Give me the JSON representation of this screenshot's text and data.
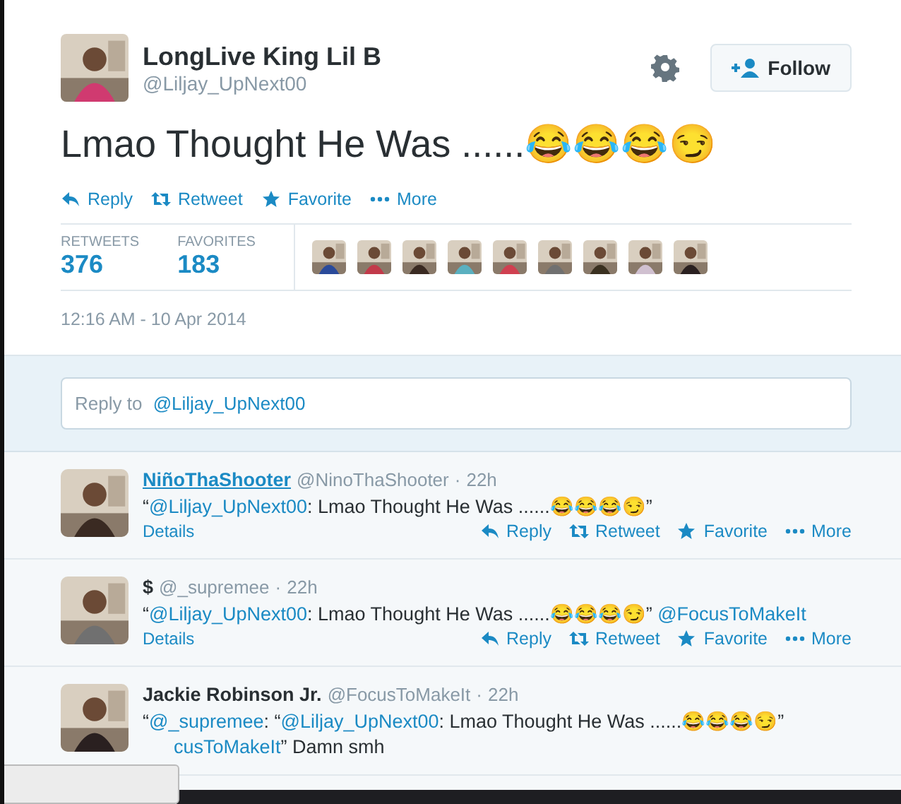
{
  "tweet": {
    "name": "LongLive King Lil B",
    "handle": "@Liljay_UpNext00",
    "follow_label": "Follow",
    "text": "Lmao Thought He Was ......😂😂😂😏",
    "actions": [
      {
        "kind": "reply",
        "label": "Reply"
      },
      {
        "kind": "retweet",
        "label": "Retweet"
      },
      {
        "kind": "favorite",
        "label": "Favorite"
      },
      {
        "kind": "more",
        "label": "More"
      }
    ],
    "stats": [
      {
        "label": "RETWEETS",
        "value": "376"
      },
      {
        "label": "FAVORITES",
        "value": "183"
      }
    ],
    "timestamp": "12:16 AM - 10 Apr 2014"
  },
  "reply_box": {
    "placeholder": "Reply to ",
    "mention": "@Liljay_UpNext00"
  },
  "replies": [
    {
      "name": "NiñoThaShooter",
      "name_link": true,
      "handle": "@NinoThaShooter",
      "separator": "·",
      "time": "22h",
      "lines": [
        [
          {
            "kind": "plain",
            "text": "“"
          },
          {
            "kind": "mention",
            "text": "@Liljay_UpNext00"
          },
          {
            "kind": "plain",
            "text": ": Lmao Thought He Was ......😂😂😂😏”"
          }
        ]
      ],
      "details": "Details",
      "actions": [
        {
          "kind": "reply",
          "label": "Reply"
        },
        {
          "kind": "retweet",
          "label": "Retweet"
        },
        {
          "kind": "favorite",
          "label": "Favorite"
        },
        {
          "kind": "more",
          "label": "More"
        }
      ]
    },
    {
      "name": "$",
      "name_link": false,
      "handle": "@_supremee",
      "separator": "·",
      "time": "22h",
      "lines": [
        [
          {
            "kind": "plain",
            "text": "“"
          },
          {
            "kind": "mention",
            "text": "@Liljay_UpNext00"
          },
          {
            "kind": "plain",
            "text": ": Lmao Thought He Was ......😂😂😂😏” "
          },
          {
            "kind": "mention",
            "text": "@FocusToMakeIt"
          }
        ]
      ],
      "details": "Details",
      "actions": [
        {
          "kind": "reply",
          "label": "Reply"
        },
        {
          "kind": "retweet",
          "label": "Retweet"
        },
        {
          "kind": "favorite",
          "label": "Favorite"
        },
        {
          "kind": "more",
          "label": "More"
        }
      ]
    },
    {
      "name": "Jackie Robinson Jr.",
      "name_link": false,
      "handle": "@FocusToMakeIt",
      "separator": "·",
      "time": "22h",
      "lines": [
        [
          {
            "kind": "plain",
            "text": "“"
          },
          {
            "kind": "mention",
            "text": "@_supremee"
          },
          {
            "kind": "plain",
            "text": ": “"
          },
          {
            "kind": "mention",
            "text": "@Liljay_UpNext00"
          },
          {
            "kind": "plain",
            "text": ": Lmao Thought He Was ......😂😂😂😏”"
          }
        ],
        [
          {
            "kind": "mention",
            "text": "cusToMakeIt"
          },
          {
            "kind": "plain",
            "text": "” Damn smh"
          }
        ]
      ]
    }
  ]
}
